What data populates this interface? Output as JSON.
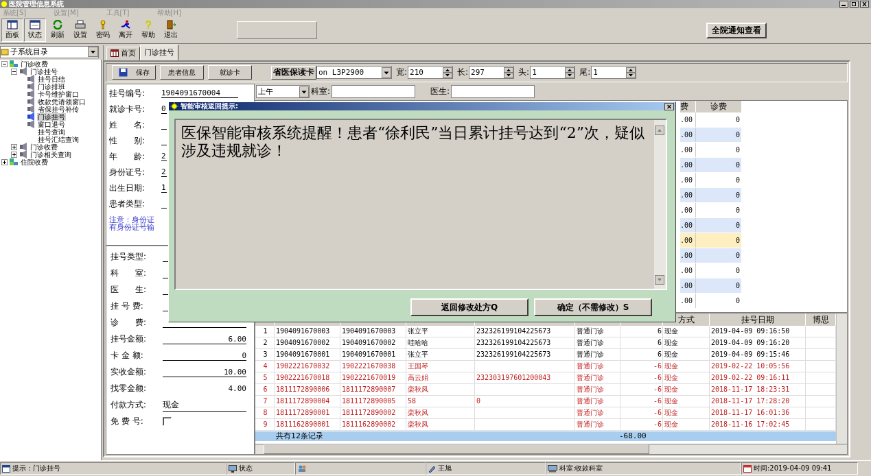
{
  "window": {
    "title": "医院管理信息系统"
  },
  "menu": [
    {
      "label": "系统[S]",
      "disabled": true
    },
    {
      "label": "设置[M]",
      "disabled": true
    },
    {
      "label": "工具[T]",
      "disabled": true
    },
    {
      "label": "帮助[H]",
      "disabled": true
    }
  ],
  "toolbar": [
    {
      "label": "面板",
      "kind": "panel",
      "pressed": true
    },
    {
      "label": "状态",
      "kind": "status",
      "pressed": true
    },
    {
      "label": "刷新",
      "kind": "refresh",
      "pressed": false
    },
    {
      "label": "设置",
      "kind": "printer",
      "pressed": false
    },
    {
      "label": "密码",
      "kind": "key",
      "pressed": false
    },
    {
      "label": "离开",
      "kind": "runner",
      "pressed": false
    },
    {
      "label": "帮助",
      "kind": "help",
      "pressed": false
    },
    {
      "label": "退出",
      "kind": "exit",
      "pressed": false
    }
  ],
  "notice_button": "全院通知查看",
  "sidebar": {
    "selector": "子系统目录",
    "tree": [
      {
        "label": "门诊收费",
        "kind": "module",
        "expanded": true,
        "selected": false,
        "children": [
          {
            "label": "门诊挂号",
            "kind": "function",
            "expanded": true,
            "selected": false,
            "children": [
              {
                "label": "挂号日结",
                "kind": "function",
                "selected": false
              },
              {
                "label": "门诊排班",
                "kind": "function",
                "selected": false
              },
              {
                "label": "卡号维护窗口",
                "kind": "function",
                "selected": false
              },
              {
                "label": "收款凭请领窗口",
                "kind": "function",
                "selected": false
              },
              {
                "label": "省保挂号补传",
                "kind": "function",
                "selected": false
              },
              {
                "label": "门诊挂号",
                "kind": "function",
                "selected": true
              },
              {
                "label": "窗口退号",
                "kind": "function",
                "selected": false
              },
              {
                "label": "挂号查询",
                "kind": "plain",
                "selected": false
              },
              {
                "label": "挂号汇结查询",
                "kind": "plain",
                "selected": false
              }
            ]
          },
          {
            "label": "门诊收费",
            "kind": "function",
            "expanded": false,
            "selected": false
          },
          {
            "label": "门诊相关查询",
            "kind": "function",
            "expanded": false,
            "selected": false
          }
        ]
      },
      {
        "label": "住院收费",
        "kind": "module",
        "expanded": false,
        "selected": false
      }
    ]
  },
  "tabs": [
    {
      "label": "首页",
      "kind": "home",
      "selected": false
    },
    {
      "label": "门诊挂号",
      "kind": "plain",
      "selected": true
    }
  ],
  "actions": [
    {
      "label": "保存",
      "kind": "save"
    },
    {
      "label": "患者信息",
      "kind": "plain"
    },
    {
      "label": "就诊卡",
      "kind": "plain"
    }
  ],
  "card_reader_button": "省医保读卡",
  "printer": {
    "value": "on L3P2900",
    "fields": [
      {
        "label": "宽:",
        "value": "210"
      },
      {
        "label": "长:",
        "value": "297"
      },
      {
        "label": "头:",
        "value": "1"
      },
      {
        "label": "尾:",
        "value": "1"
      }
    ]
  },
  "form": {
    "fields": [
      {
        "label": "挂号编号:",
        "value": "1904091670004"
      },
      {
        "label": "就诊卡号:",
        "value": "0"
      },
      {
        "label": "姓　　名:"
      },
      {
        "label": "性　　别:"
      },
      {
        "label": "年　　龄:",
        "value": "2"
      },
      {
        "label": "身份证号:",
        "value": "2"
      },
      {
        "label": "出生日期:",
        "value": "1"
      },
      {
        "label": "患者类型:"
      }
    ],
    "notice": [
      "注意：身份证",
      "有身份证号输"
    ],
    "charges": [
      {
        "label": "挂号类型:"
      },
      {
        "label": "科　　室:"
      },
      {
        "label": "医　　生:"
      },
      {
        "label": "挂 号 费:"
      },
      {
        "label": "诊　　费:"
      },
      {
        "label": "挂号金额:",
        "value": "6.00"
      },
      {
        "label": "卡 金 额:",
        "value": "0"
      },
      {
        "label": "实收金额:",
        "value": "10.00"
      },
      {
        "label": "找零金额:",
        "value": "4.00",
        "underlined": false
      },
      {
        "label": "付款方式:",
        "value": "现金"
      }
    ],
    "free": {
      "label": "免 费 号:",
      "checked": false
    }
  },
  "filter": {
    "period": "上午",
    "department_label": "科室:",
    "doctor_label": "医生:"
  },
  "fee_grid": {
    "columns": [
      "费",
      "诊费"
    ],
    "rows": [
      {
        "fee": ".00",
        "diagnosis_fee": "0",
        "selected": false
      },
      {
        "fee": ".00",
        "diagnosis_fee": "0",
        "selected": false
      },
      {
        "fee": ".00",
        "diagnosis_fee": "0",
        "selected": false
      },
      {
        "fee": ".00",
        "diagnosis_fee": "0",
        "selected": false
      },
      {
        "fee": ".00",
        "diagnosis_fee": "0",
        "selected": false
      },
      {
        "fee": ".00",
        "diagnosis_fee": "0",
        "selected": false
      },
      {
        "fee": ".00",
        "diagnosis_fee": "0",
        "selected": false
      },
      {
        "fee": ".00",
        "diagnosis_fee": "0",
        "selected": false
      },
      {
        "fee": ".00",
        "diagnosis_fee": "0",
        "selected": true
      },
      {
        "fee": ".00",
        "diagnosis_fee": "0",
        "selected": false
      },
      {
        "fee": ".00",
        "diagnosis_fee": "0",
        "selected": false
      },
      {
        "fee": ".00",
        "diagnosis_fee": "0",
        "selected": false
      },
      {
        "fee": ".00",
        "diagnosis_fee": "0",
        "selected": false
      }
    ]
  },
  "records": {
    "columns": [
      "方式",
      "挂号日期",
      "博思"
    ],
    "rows": [
      {
        "no": "1",
        "reg_no": "1904091670003",
        "card_no": "1904091670003",
        "name": "张立平",
        "id_number": "232326199104225673",
        "type": "普通门诊",
        "amount": "6",
        "payment": "现金",
        "date": "2019-04-09 09:16:50",
        "refunded": false
      },
      {
        "no": "2",
        "reg_no": "1904091670002",
        "card_no": "1904091670002",
        "name": "哇哈哈",
        "id_number": "232326199104225673",
        "type": "普通门诊",
        "amount": "6",
        "payment": "现金",
        "date": "2019-04-09 09:16:20",
        "refunded": false
      },
      {
        "no": "3",
        "reg_no": "1904091670001",
        "card_no": "1904091670001",
        "name": "张立平",
        "id_number": "232326199104225673",
        "type": "普通门诊",
        "amount": "6",
        "payment": "现金",
        "date": "2019-04-09 09:15:46",
        "refunded": false
      },
      {
        "no": "4",
        "reg_no": "1902221670032",
        "card_no": "1902221670038",
        "name": "王国琴",
        "type": "普通门诊",
        "amount": "-6",
        "payment": "现金",
        "date": "2019-02-22 10:05:56",
        "refunded": true
      },
      {
        "no": "5",
        "reg_no": "1902221670018",
        "card_no": "1902221670019",
        "name": "高云娟",
        "id_number": "232303197601200043",
        "type": "普通门诊",
        "amount": "-6",
        "payment": "现金",
        "date": "2019-02-22 09:16:11",
        "refunded": true
      },
      {
        "no": "6",
        "reg_no": "1811172890006",
        "card_no": "1811172890007",
        "name": "栾秋凤",
        "type": "普通门诊",
        "amount": "-6",
        "payment": "现金",
        "date": "2018-11-17 18:23:31",
        "refunded": true
      },
      {
        "no": "7",
        "reg_no": "1811172890004",
        "card_no": "1811172890005",
        "name": "58",
        "id_number": "0",
        "type": "普通门诊",
        "amount": "-6",
        "payment": "现金",
        "date": "2018-11-17 17:28:20",
        "refunded": true
      },
      {
        "no": "8",
        "reg_no": "1811172890001",
        "card_no": "1811172890002",
        "name": "栾秋凤",
        "type": "普通门诊",
        "amount": "-6",
        "payment": "现金",
        "date": "2018-11-17 16:01:36",
        "refunded": true
      },
      {
        "no": "9",
        "reg_no": "1811162890001",
        "card_no": "1811162890002",
        "name": "栾秋凤",
        "type": "普通门诊",
        "amount": "-6",
        "payment": "现金",
        "date": "2018-11-16 17:02:45",
        "refunded": true
      }
    ],
    "footer": {
      "count": "共有12条记录",
      "total": "-68.00"
    }
  },
  "dialog": {
    "title": "智能审核返回提示:",
    "message": "医保智能审核系统提醒！患者“徐利民”当日累计挂号达到“2”次，疑似涉及违规就诊！",
    "buttons": [
      "返回修改处方Q",
      "确定（不需修改）S"
    ]
  },
  "status_bar": [
    {
      "text": "提示：门诊挂号",
      "kind": "tip"
    },
    {
      "text": "状态",
      "kind": "status"
    },
    {
      "kind": "user-group"
    },
    {
      "text": "王旭",
      "kind": "user"
    },
    {
      "text": "科室:收款科室",
      "kind": "dept"
    },
    {
      "text": "时间:2019-04-09 09:41",
      "kind": "clock"
    }
  ]
}
